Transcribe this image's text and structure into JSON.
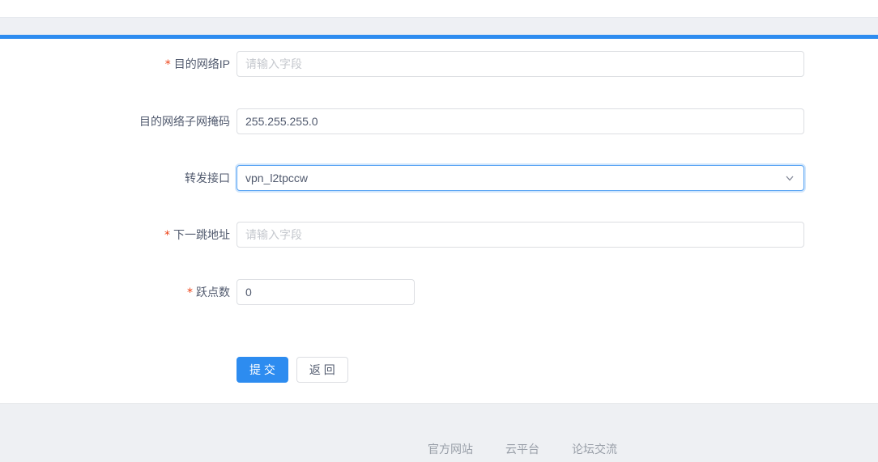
{
  "theme": {
    "accent_color": "#2d8cf0",
    "required_color": "#ed4014",
    "band_color": "#eef0f4"
  },
  "form": {
    "required_marker": "*",
    "fields": [
      {
        "label": "目的网络IP",
        "required": true,
        "type": "text",
        "value": "",
        "placeholder": "请输入字段"
      },
      {
        "label": "目的网络子网掩码",
        "required": false,
        "type": "text",
        "value": "255.255.255.0",
        "placeholder": ""
      },
      {
        "label": "转发接口",
        "required": false,
        "type": "select",
        "value": "vpn_l2tpccw",
        "state": "focused"
      },
      {
        "label": "下一跳地址",
        "required": true,
        "type": "text",
        "value": "",
        "placeholder": "请输入字段"
      },
      {
        "label": "跃点数",
        "required": true,
        "type": "text",
        "value": "0",
        "placeholder": ""
      }
    ],
    "buttons": {
      "submit_label": "提 交",
      "back_label": "返 回"
    }
  },
  "footer": {
    "links": [
      {
        "label": "官方网站"
      },
      {
        "label": "云平台"
      },
      {
        "label": "论坛交流"
      }
    ]
  }
}
